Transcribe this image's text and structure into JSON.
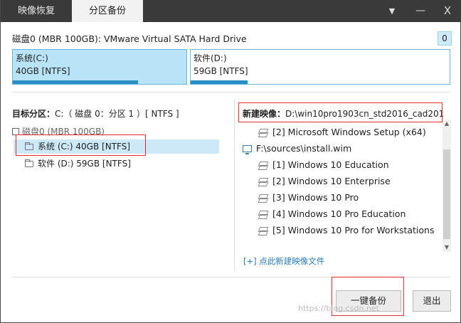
{
  "tabs": [
    "映像恢复",
    "分区备份"
  ],
  "title_buttons": {
    "menu": "▼",
    "minimize": "—",
    "close": "X"
  },
  "disk": {
    "title": "磁盘0 (MBR 100GB): VMware Virtual SATA Hard Drive",
    "badge": "0",
    "partitions": [
      {
        "name": "系统(C:)",
        "detail": "40GB [NTFS]",
        "used_fraction": 0.72
      },
      {
        "name": "软件(D:)",
        "detail": "59GB [NTFS]",
        "used_fraction": 0.22
      }
    ]
  },
  "left": {
    "label": "目标分区：",
    "value": "C:（ 磁盘 0：分区 1 ）[ NTFS ]",
    "tree_root": "磁盘0 (MBR 100GB)",
    "items": [
      {
        "label": "系统 (C:) 40GB [NTFS]"
      },
      {
        "label": "软件 (D:) 59GB [NTFS]"
      }
    ]
  },
  "right": {
    "label": "新建映像：",
    "value": "D:\\win10pro1903cn_std2016_cad201...",
    "images": [
      {
        "label": "[2] Microsoft Windows Setup (x64)",
        "icon": "image-stack-icon",
        "indent": true
      },
      {
        "label": "F:\\sources\\install.wim",
        "icon": "monitor-icon",
        "indent": false
      },
      {
        "label": "[1] Windows 10 Education",
        "icon": "image-stack-icon",
        "indent": true
      },
      {
        "label": "[2] Windows 10 Enterprise",
        "icon": "image-stack-icon",
        "indent": true
      },
      {
        "label": "[3] Windows 10 Pro",
        "icon": "image-stack-icon",
        "indent": true
      },
      {
        "label": "[4] Windows 10 Pro Education",
        "icon": "image-stack-icon",
        "indent": true
      },
      {
        "label": "[5] Windows 10 Pro for Workstations",
        "icon": "image-stack-icon",
        "indent": true
      }
    ],
    "add_link": "[+] 点此新建映像文件"
  },
  "buttons": {
    "backup": "一键备份",
    "exit": "退出"
  },
  "watermark": "https://blog.csdn.net"
}
